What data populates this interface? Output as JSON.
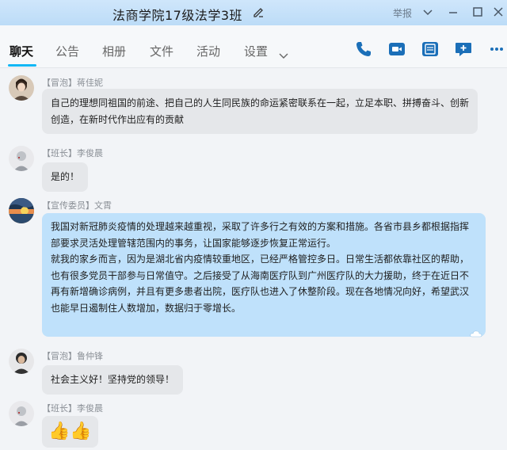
{
  "window": {
    "title": "法商学院17级法学3班",
    "report_label": "举报"
  },
  "tabs": [
    "聊天",
    "公告",
    "相册",
    "文件",
    "活动",
    "设置"
  ],
  "messages": [
    {
      "role": "【冒泡】",
      "name": "蒋佳妮",
      "text": "自己的理想同祖国的前途、把自己的人生同民族的命运紧密联系在一起，立足本职、拼搏奋斗、创新创造，在新时代作出应有的贡献"
    },
    {
      "role": "【班长】",
      "name": "李俊晨",
      "text": "是的！"
    },
    {
      "role": "【宣传委员】",
      "name": "文霄",
      "paragraphs": [
        "我国对新冠肺炎疫情的处理越来越重视，采取了许多行之有效的方案和措施。各省市县乡都根据指挥部要求灵活处理管辖范围内的事务，让国家能够逐步恢复正常运行。",
        "就我的家乡而言，因为是湖北省内疫情较重地区，已经严格管控多日。日常生活都依靠社区的帮助，也有很多党员干部参与日常值守。之后接受了从海南医疗队到广州医疗队的大力援助，终于在近日不再有新增确诊病例，并且有更多患者出院，医疗队也进入了休整阶段。现在各地情况向好，希望武汉也能早日遏制住人数增加，数据归于零增长。"
      ]
    },
    {
      "role": "【冒泡】",
      "name": "鲁仲锋",
      "text": "社会主义好！坚持党的领导！"
    },
    {
      "role": "【班长】",
      "name": "李俊晨",
      "emoji": "👍👍"
    }
  ],
  "colors": {
    "accent": "#12b7f5",
    "titlebar": "#c6e1f9",
    "bubble_gray": "#e5e7ea",
    "bubble_blue": "#bfe1fb"
  }
}
